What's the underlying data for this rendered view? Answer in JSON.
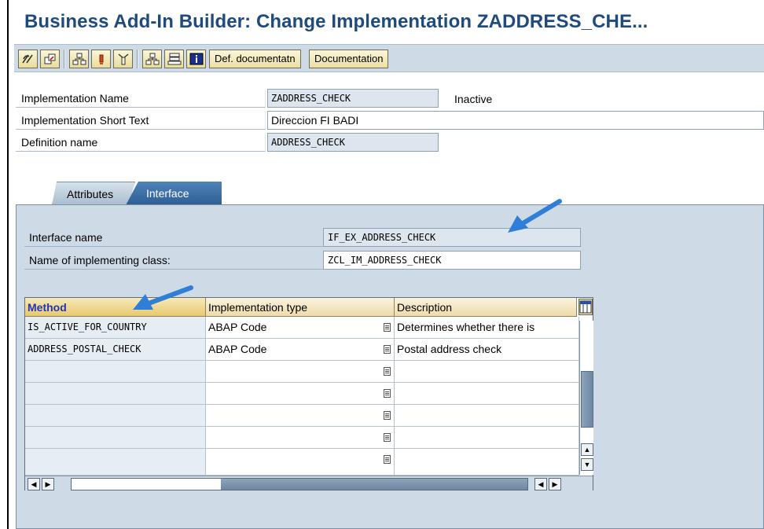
{
  "window": {
    "title": "Business Add-In Builder: Change Implementation ZADDRESS_CHE..."
  },
  "toolbar": {
    "icon_buttons": [
      "display-change-toggle-icon",
      "other-object-icon",
      "hierarchy-icon",
      "activate-icon",
      "deactivate-icon",
      "object-list-icon",
      "where-used-icon",
      "info-icon"
    ],
    "def_documentation_label": "Def. documentatn",
    "documentation_label": "Documentation"
  },
  "header": {
    "implementation_name": {
      "label": "Implementation Name",
      "value": "ZADDRESS_CHECK",
      "status": "Inactive"
    },
    "short_text": {
      "label": "Implementation Short Text",
      "value": "Direccion FI BADI"
    },
    "definition_name": {
      "label": "Definition name",
      "value": "ADDRESS_CHECK"
    }
  },
  "tabs": {
    "attributes": "Attributes",
    "interface": "Interface",
    "active": "Interface"
  },
  "interface_tab": {
    "interface_name": {
      "label": "Interface name",
      "value": "IF_EX_ADDRESS_CHECK"
    },
    "implementing_class": {
      "label": "Name of implementing class:",
      "value": "ZCL_IM_ADDRESS_CHECK"
    }
  },
  "methods_table": {
    "columns": [
      "Method",
      "Implementation type",
      "Description"
    ],
    "rows": [
      {
        "method": "IS_ACTIVE_FOR_COUNTRY",
        "type": "ABAP Code",
        "description": "Determines whether there is"
      },
      {
        "method": "ADDRESS_POSTAL_CHECK",
        "type": "ABAP Code",
        "description": "Postal address check"
      },
      {
        "method": "",
        "type": "",
        "description": ""
      },
      {
        "method": "",
        "type": "",
        "description": ""
      },
      {
        "method": "",
        "type": "",
        "description": ""
      },
      {
        "method": "",
        "type": "",
        "description": ""
      },
      {
        "method": "",
        "type": "",
        "description": ""
      }
    ]
  },
  "colors": {
    "title": "#1f4a7e",
    "toolbar_bg": "#cedae6",
    "active_tab": "#3a6ea5",
    "annotation_arrow": "#2f7fd8",
    "selected_header_text": "#2334b4"
  }
}
